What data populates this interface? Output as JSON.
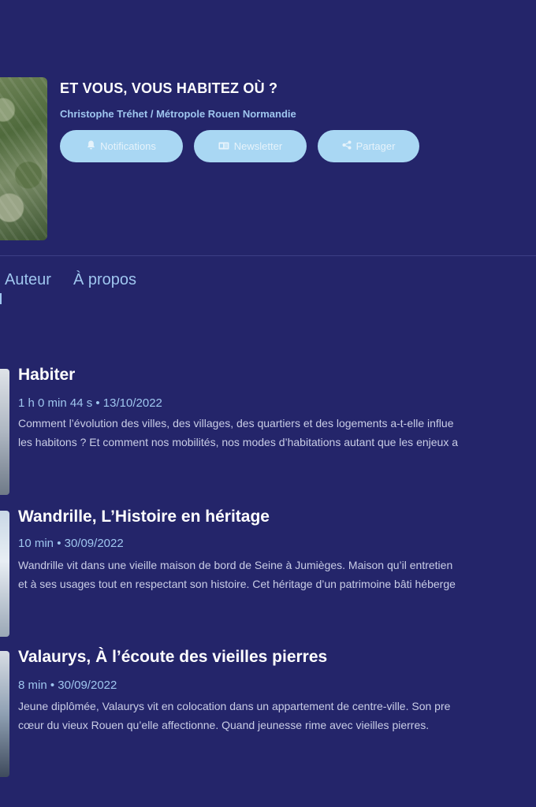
{
  "podcast": {
    "title": "ET VOUS, VOUS HABITEZ OÙ ?",
    "author": "Christophe Tréhet / Métropole Rouen Normandie"
  },
  "actions": {
    "notifications": "Notifications",
    "newsletter": "Newsletter",
    "share": "Partager"
  },
  "icons": {
    "notifications": "bell-icon",
    "newsletter": "newsletter-icon",
    "share": "share-icon"
  },
  "tabs": [
    {
      "label": "Auteur"
    },
    {
      "label": "À propos"
    }
  ],
  "episodes": [
    {
      "title": "Habiter",
      "meta": "1 h 0 min 44 s • 13/10/2022",
      "desc_line1": "Comment l’évolution des villes, des villages, des quartiers et des logements a-t-elle influe",
      "desc_line2": "les habitons ? Et comment nos mobilités, nos modes d’habitations autant que les enjeux a"
    },
    {
      "title": "Wandrille, L’Histoire en héritage",
      "meta": "10 min • 30/09/2022",
      "desc_line1": "Wandrille vit dans une vieille maison de bord de Seine à Jumièges.  Maison qu’il entretien",
      "desc_line2": "et à ses usages tout en  respectant son histoire. Cet héritage d’un patrimoine bâti héberge"
    },
    {
      "title": "Valaurys, À l’écoute des vieilles pierres",
      "meta": "8 min • 30/09/2022",
      "desc_line1": "Jeune diplômée, Valaurys vit en colocation dans un appartement de  centre-ville. Son pre",
      "desc_line2": "cœur du vieux Rouen qu’elle  affectionne. Quand jeunesse rime avec vieilles pierres."
    }
  ],
  "colors": {
    "background": "#24256a",
    "accent": "#9fc6ef",
    "pill": "#a9d7f3"
  }
}
